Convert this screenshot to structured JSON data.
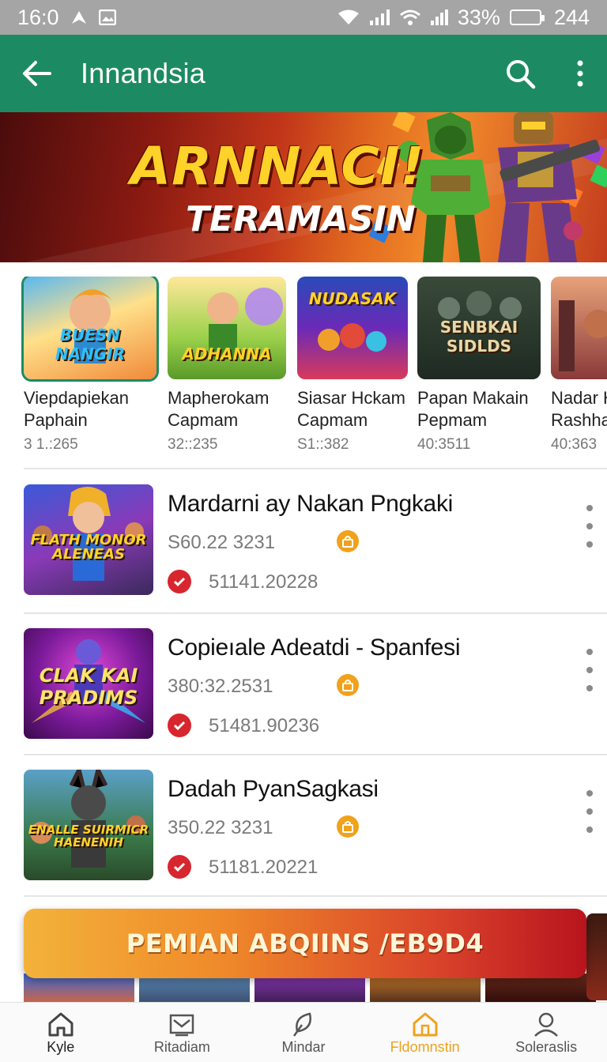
{
  "status_bar": {
    "time": "16:0",
    "battery_percent": "33%",
    "extra": "244"
  },
  "app_bar": {
    "title": "Innandsia",
    "back_icon": "arrow-left-icon",
    "search_icon": "search-icon",
    "menu_icon": "more-vert-icon"
  },
  "banner": {
    "headline": "ARNNACI!",
    "subhead": "TERAMASIN"
  },
  "featured": [
    {
      "thumb_label": "BUESN NANGIR",
      "name_line1": "Viepdapiekan",
      "name_line2": "Paphain",
      "meta": "3 1.:265"
    },
    {
      "thumb_label": "ADHANNA",
      "name_line1": "Mapherokam",
      "name_line2": "Capmam",
      "meta": "32::235"
    },
    {
      "thumb_label": "NUDASAK",
      "name_line1": "Siasar Hckam",
      "name_line2": "Capmam",
      "meta": "S1::382"
    },
    {
      "thumb_label": "SENBKAI SIDLDS",
      "name_line1": "Papan Makain",
      "name_line2": "Pepmam",
      "meta": "40:3511"
    },
    {
      "thumb_label": "",
      "name_line1": "Nadar H",
      "name_line2": "Rashhar",
      "meta": "40:363"
    }
  ],
  "list": [
    {
      "thumb_label": "FLATH MONOR ALENEAS",
      "title": "Mardarni ay Nakan Pngkaki",
      "subtitle": "S60.22 3231",
      "stat": "51141.20228"
    },
    {
      "thumb_label": "CLAK KAI PRADIMS",
      "title": "Copieıale Adeatdi - Spanfesi",
      "subtitle": "380:32.2531",
      "stat": "51481.90236"
    },
    {
      "thumb_label": "ENALLE SUIRMICR HAENENIH",
      "title": "Dadah PyanSagkasi",
      "subtitle": "350.22 3231",
      "stat": "51181.20221"
    }
  ],
  "promo": {
    "text": "PEMIAN ABQIINS /EB9D4"
  },
  "bottom_nav": [
    {
      "label": "Kyle",
      "icon": "home-icon",
      "active": false
    },
    {
      "label": "Ritadiam",
      "icon": "inbox-icon",
      "active": false
    },
    {
      "label": "Mindar",
      "icon": "leaf-icon",
      "active": false
    },
    {
      "label": "Fldomnstin",
      "icon": "house-icon",
      "active": true
    },
    {
      "label": "Soleraslis",
      "icon": "person-icon",
      "active": false
    }
  ],
  "colors": {
    "app_bar": "#1c8b64",
    "accent": "#f0a21b",
    "check": "#d7262e"
  }
}
